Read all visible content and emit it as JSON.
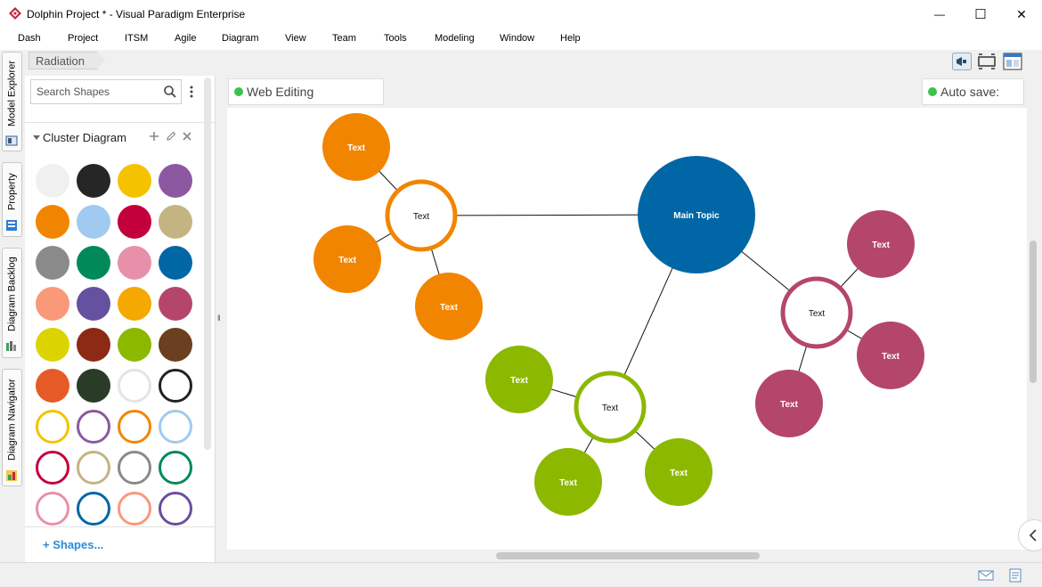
{
  "window": {
    "title": "Dolphin Project * - Visual Paradigm Enterprise",
    "minimize_glyph": "—",
    "maximize_glyph": "☐",
    "close_glyph": "✕"
  },
  "menu": [
    "Dash",
    "Project",
    "ITSM",
    "Agile",
    "Diagram",
    "View",
    "Team",
    "Tools",
    "Modeling",
    "Window",
    "Help"
  ],
  "left_tabs": [
    "Model Explorer",
    "Property",
    "Diagram Backlog",
    "Diagram Navigator"
  ],
  "breadcrumb": {
    "item": "Radiation"
  },
  "palette": {
    "search_placeholder": "Search Shapes",
    "group_title": "Cluster Diagram",
    "footer_link": "Shapes...",
    "footer_plus": "+",
    "swatches": [
      {
        "kind": "fill",
        "color": "#f0f0f0"
      },
      {
        "kind": "fill",
        "color": "#262626"
      },
      {
        "kind": "fill",
        "color": "#f5c200"
      },
      {
        "kind": "fill",
        "color": "#8c58a0"
      },
      {
        "kind": "fill",
        "color": "#f28500"
      },
      {
        "kind": "fill",
        "color": "#a0caf0"
      },
      {
        "kind": "fill",
        "color": "#c4003c"
      },
      {
        "kind": "fill",
        "color": "#c4b482"
      },
      {
        "kind": "fill",
        "color": "#8a8a8a"
      },
      {
        "kind": "fill",
        "color": "#008a5a"
      },
      {
        "kind": "fill",
        "color": "#e890aa"
      },
      {
        "kind": "fill",
        "color": "#0066a6"
      },
      {
        "kind": "fill",
        "color": "#fa987a"
      },
      {
        "kind": "fill",
        "color": "#6650a0"
      },
      {
        "kind": "fill",
        "color": "#f5a800"
      },
      {
        "kind": "fill",
        "color": "#b4466c"
      },
      {
        "kind": "fill",
        "color": "#dcd400"
      },
      {
        "kind": "fill",
        "color": "#8c2a16"
      },
      {
        "kind": "fill",
        "color": "#8cb800"
      },
      {
        "kind": "fill",
        "color": "#6a4020"
      },
      {
        "kind": "fill",
        "color": "#e65a28"
      },
      {
        "kind": "fill",
        "color": "#2a3c28"
      },
      {
        "kind": "ring",
        "color": "#e4e4e4"
      },
      {
        "kind": "ring",
        "color": "#222222"
      },
      {
        "kind": "ring",
        "color": "#f5c200"
      },
      {
        "kind": "ring",
        "color": "#8c58a0"
      },
      {
        "kind": "ring",
        "color": "#f28500"
      },
      {
        "kind": "ring",
        "color": "#a0caf0"
      },
      {
        "kind": "ring",
        "color": "#c4003c"
      },
      {
        "kind": "ring",
        "color": "#c4b482"
      },
      {
        "kind": "ring",
        "color": "#8a8a8a"
      },
      {
        "kind": "ring",
        "color": "#008a5a"
      },
      {
        "kind": "ring",
        "color": "#e890aa"
      },
      {
        "kind": "ring",
        "color": "#0066a6"
      },
      {
        "kind": "ring",
        "color": "#fa987a"
      },
      {
        "kind": "ring",
        "color": "#6650a0"
      }
    ]
  },
  "editor": {
    "web_editing_label": "Web Editing Experience",
    "autosave_label": "Auto save: On",
    "status_color": "#3cc14d"
  },
  "diagram": {
    "main_topic": {
      "label": "Main Topic",
      "color": "#0066a6"
    },
    "clusters": [
      {
        "hub": "Text",
        "color": "#f28500",
        "children": [
          "Text",
          "Text",
          "Text"
        ]
      },
      {
        "hub": "Text",
        "color": "#b4466c",
        "children": [
          "Text",
          "Text",
          "Text"
        ]
      },
      {
        "hub": "Text",
        "color": "#8cb800",
        "children": [
          "Text",
          "Text",
          "Text"
        ]
      }
    ]
  },
  "brand_color": "#c4263a"
}
